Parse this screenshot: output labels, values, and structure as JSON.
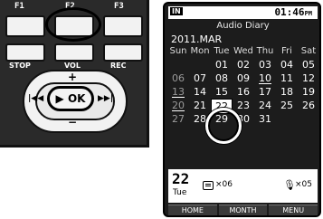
{
  "device": {
    "function_keys": [
      "F1",
      "F2",
      "F3"
    ],
    "button_labels": {
      "stop": "STOP",
      "vol": "VOL",
      "rec": "REC"
    },
    "ok_label": "▶ OK",
    "dial_symbols": {
      "plus": "+",
      "minus": "−",
      "left": "|◀◀",
      "right": "▶▶|"
    }
  },
  "screen": {
    "status": {
      "in_label": "IN",
      "time": "01:46",
      "ampm": "PM"
    },
    "title": "Audio Diary",
    "month": "2011.MAR",
    "weekdays": [
      "Sun",
      "Mon",
      "Tue",
      "Wed",
      "Thu",
      "Fri",
      "Sat"
    ],
    "weeks": [
      [
        "",
        "",
        "01",
        "02",
        "03",
        "04",
        "05"
      ],
      [
        "06",
        "07",
        "08",
        "09",
        "10",
        "11",
        "12"
      ],
      [
        "13",
        "14",
        "15",
        "16",
        "17",
        "18",
        "19"
      ],
      [
        "20",
        "21",
        "22",
        "23",
        "24",
        "25",
        "26"
      ],
      [
        "27",
        "28",
        "29",
        "30",
        "31",
        "",
        ""
      ]
    ],
    "selected_day": "22",
    "underlined_days": [
      "10",
      "13",
      "20"
    ],
    "info": {
      "day": "22",
      "weekday": "Tue",
      "memo_count": "×06",
      "voice_count": "×05"
    },
    "softkeys": [
      "HOME",
      "MONTH",
      "MENU"
    ]
  }
}
